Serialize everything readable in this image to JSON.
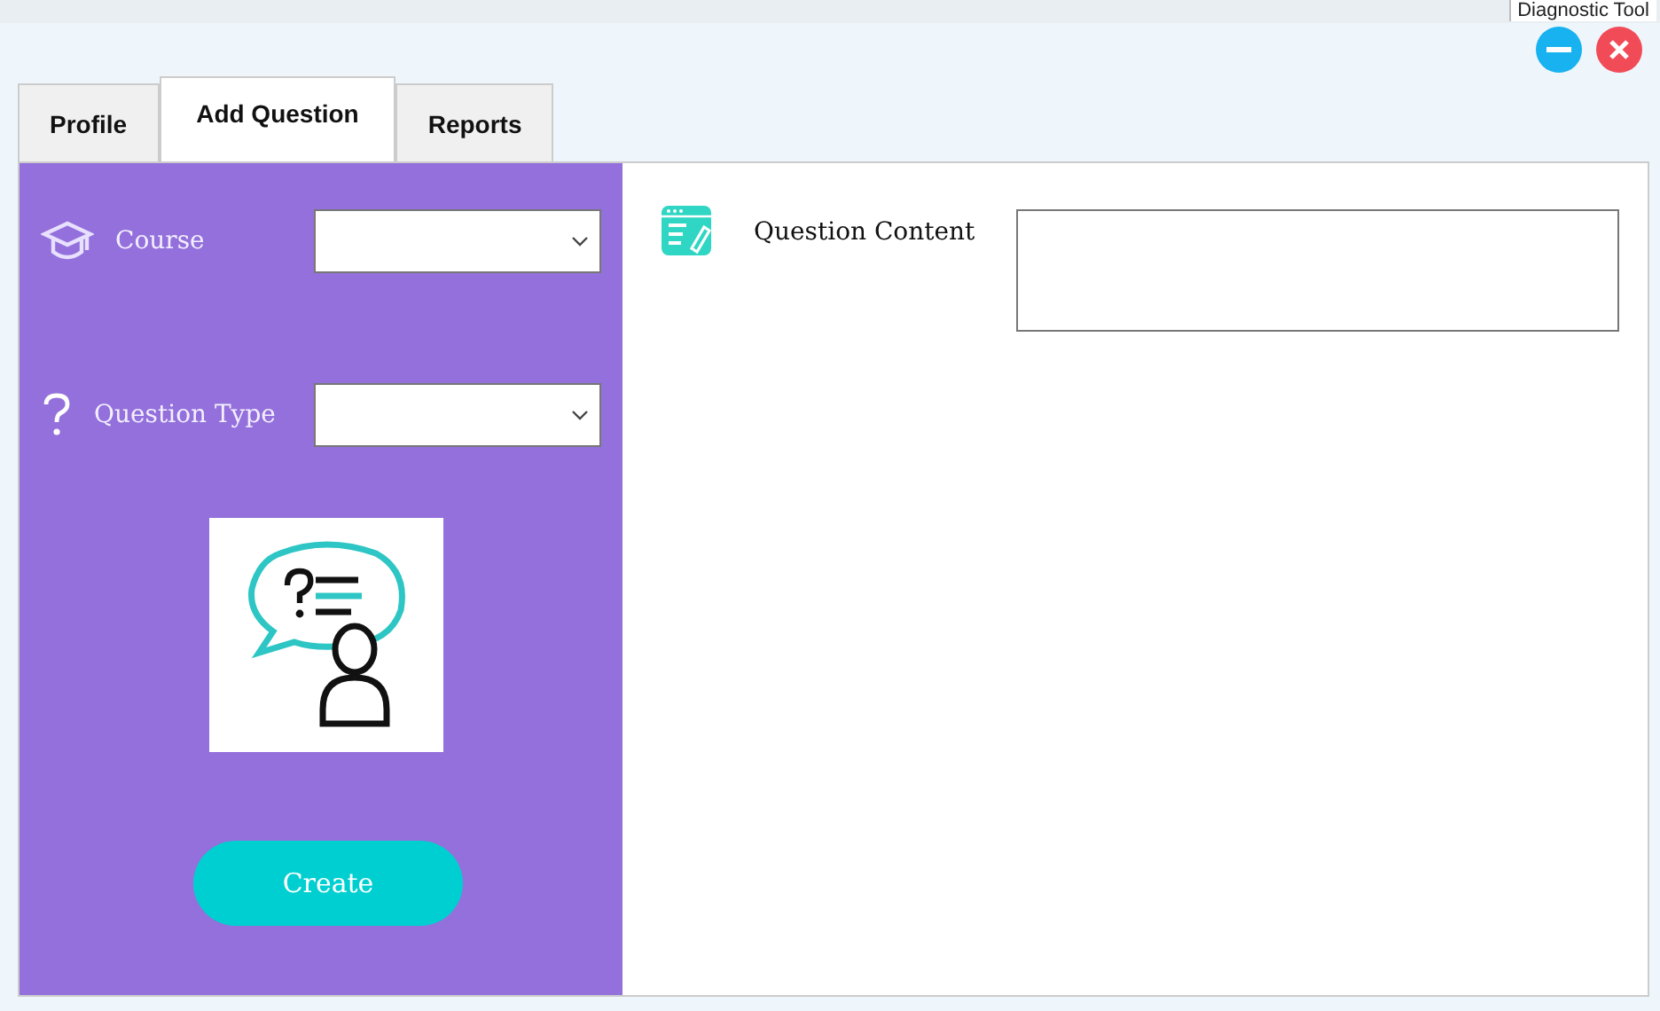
{
  "background_window": {
    "title": "Diagnostic Tool"
  },
  "tabs": [
    {
      "label": "Profile",
      "selected": false
    },
    {
      "label": "Add Question",
      "selected": true
    },
    {
      "label": "Reports",
      "selected": false
    }
  ],
  "form": {
    "fields": [
      {
        "kind": "course",
        "label": "Course"
      },
      {
        "kind": "question",
        "label": "Question Type"
      }
    ],
    "create_button": "Create"
  },
  "content": {
    "label": "Question Content"
  }
}
